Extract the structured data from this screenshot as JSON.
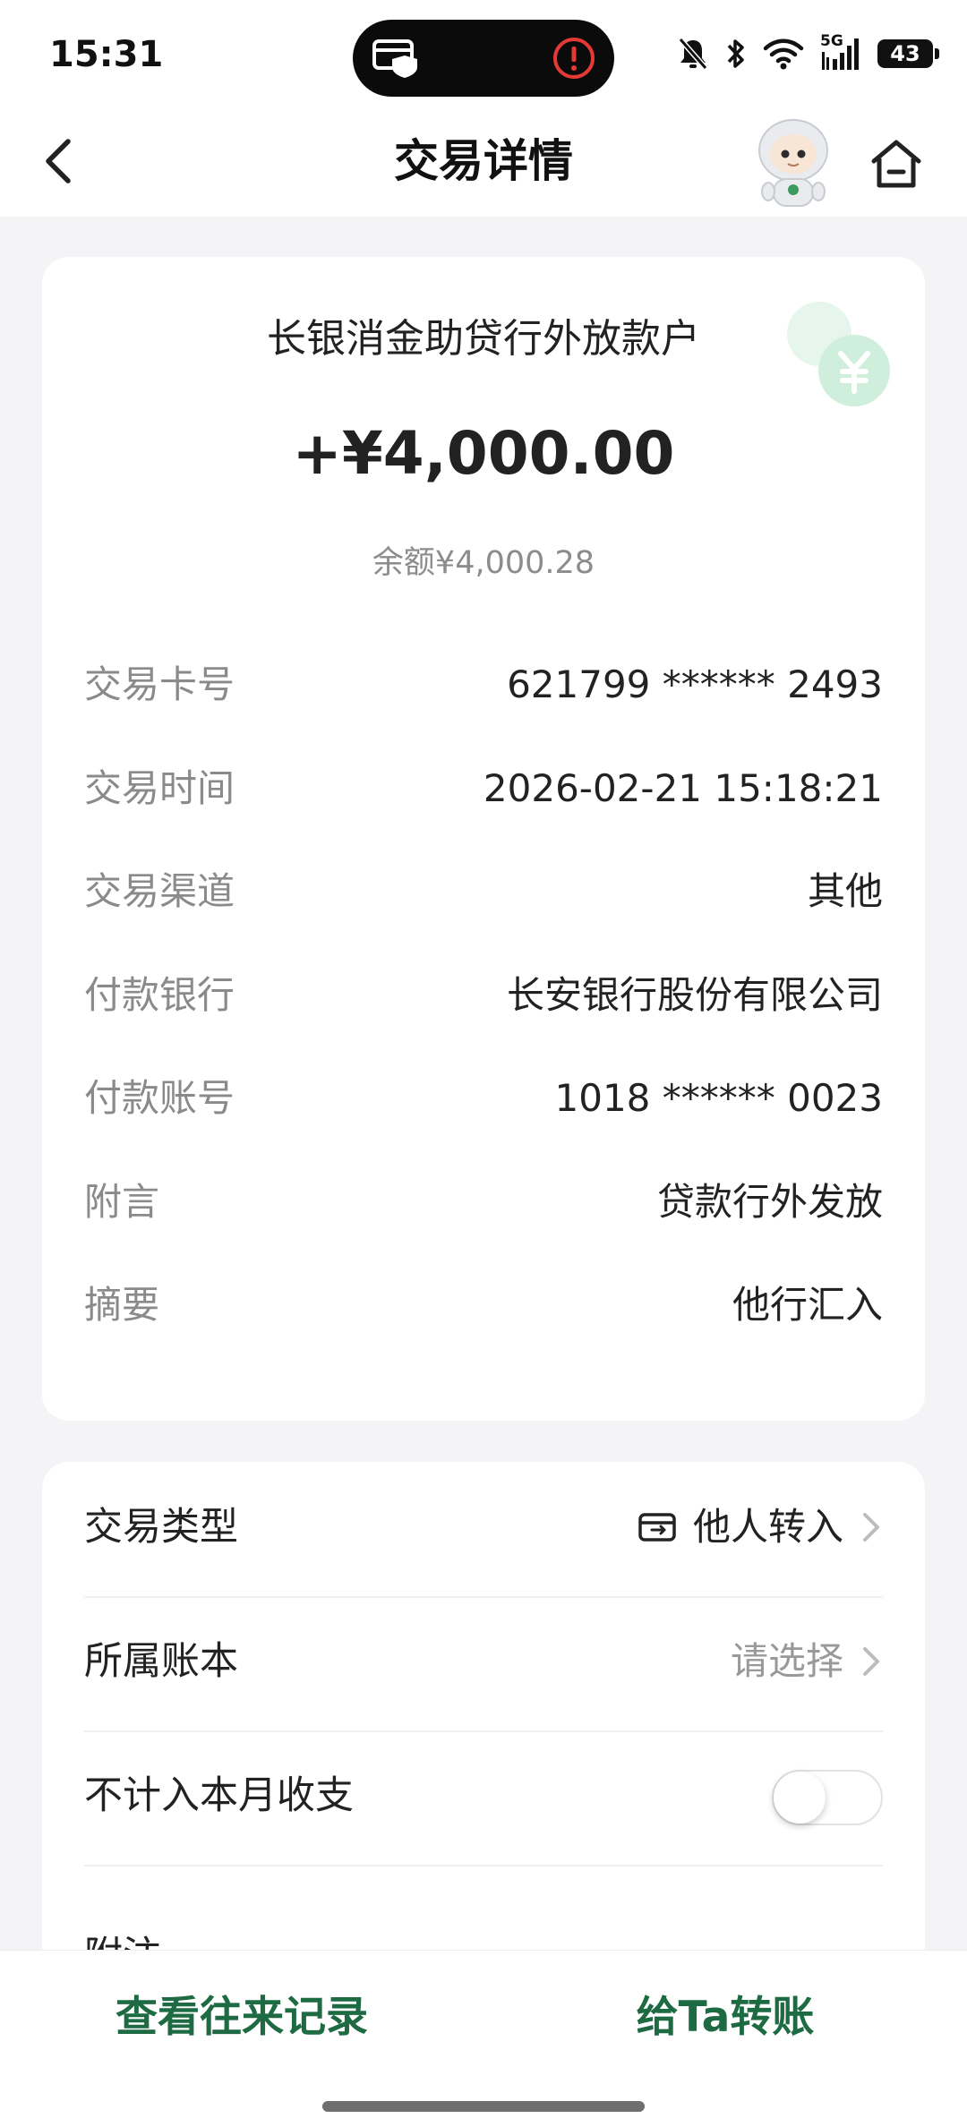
{
  "status_bar": {
    "time": "15:31",
    "network": "5G",
    "battery": "43",
    "icons": [
      "card-shield-icon",
      "alert-icon",
      "mute-bell-icon",
      "bluetooth-icon",
      "wifi-icon",
      "signal-5g-icon",
      "battery-icon"
    ]
  },
  "header": {
    "title": "交易详情",
    "icons": [
      "back-icon",
      "mascot-avatar",
      "home-icon"
    ]
  },
  "summary": {
    "account_name": "长银消金助贷行外放款户",
    "amount": "+¥4,000.00",
    "balance": "余额¥4,000.28",
    "rows": [
      {
        "label": "交易卡号",
        "value": "621799 ****** 2493"
      },
      {
        "label": "交易时间",
        "value": "2026-02-21 15:18:21"
      },
      {
        "label": "交易渠道",
        "value": "其他"
      },
      {
        "label": "付款银行",
        "value": "长安银行股份有限公司"
      },
      {
        "label": "付款账号",
        "value": "1018 ****** 0023"
      },
      {
        "label": "附言",
        "value": "贷款行外发放"
      },
      {
        "label": "摘要",
        "value": "他行汇入"
      }
    ]
  },
  "category": {
    "type_label": "交易类型",
    "type_value": "他人转入",
    "ledger_label": "所属账本",
    "ledger_value": "请选择",
    "exclude_label": "不计入本月收支",
    "exclude_enabled": false,
    "remark_label": "附注"
  },
  "bottom_bar": {
    "history_label": "查看往来记录",
    "transfer_label": "给Ta转账"
  },
  "colors": {
    "accent_green": "#1d6a43",
    "deco_green": "#8fd6a8",
    "background": "#f4f4f6"
  }
}
